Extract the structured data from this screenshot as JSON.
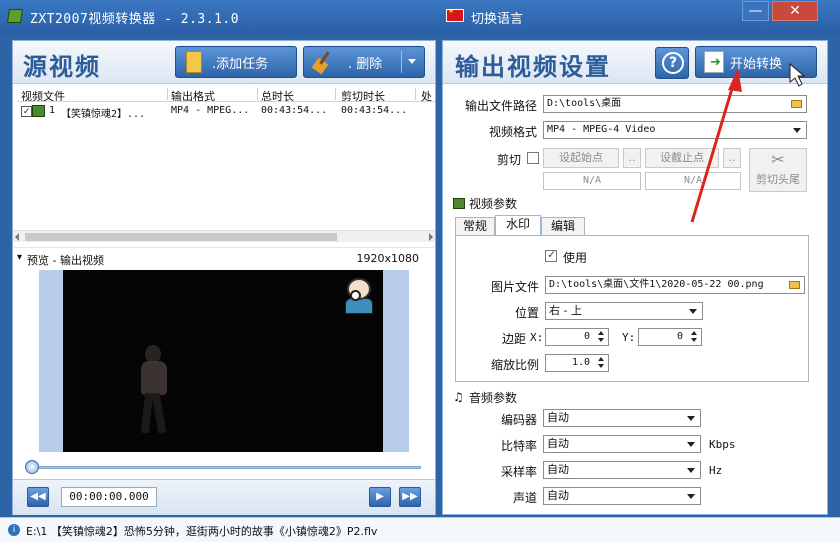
{
  "window": {
    "title": "ZXT2007视频转换器 - 2.3.1.0",
    "language_label": "切换语言",
    "minimize_glyph": "—",
    "close_glyph": "✕"
  },
  "source": {
    "title": "源视频",
    "add_task_label": ".添加任务",
    "delete_label": ". 删除",
    "columns": [
      "视频文件",
      "输出格式",
      "总时长",
      "剪切时长",
      "处"
    ],
    "rows": [
      {
        "checked": "✓",
        "index": "1",
        "file": "【笑镇惊魂2】...",
        "format": "MP4 - MPEG...",
        "duration": "00:43:54...",
        "cut_duration": "00:43:54..."
      }
    ]
  },
  "preview": {
    "label": "预览 - 输出视频",
    "resolution": "1920x1080",
    "time": "00:00:00.000",
    "prev_glyph": "◀◀",
    "play_glyph": "▶",
    "next_glyph": "▶▶"
  },
  "output": {
    "title": "输出视频设置",
    "help_glyph": "?",
    "start_label": "开始转换",
    "path_label": "输出文件路径",
    "path_value": "D:\\tools\\桌面",
    "format_label": "视频格式",
    "format_value": "MP4 - MPEG-4 Video",
    "cut_label": "剪切",
    "set_start_label": "设起始点",
    "set_end_label": "设截止点",
    "more_glyph": "..",
    "start_value": "N/A",
    "end_value": "N/A",
    "cut_head_tail_label": "剪切头尾",
    "video_params_title": "视频参数",
    "tabs": [
      "常规",
      "水印",
      "编辑"
    ],
    "watermark": {
      "use_label": "使用",
      "image_label": "图片文件",
      "image_value": "D:\\tools\\桌面\\文件1\\2020-05-22 00.png",
      "position_label": "位置",
      "position_value": "右 - 上",
      "margin_label": "边距",
      "x_label": "X:",
      "x_value": "0",
      "y_label": "Y:",
      "y_value": "0",
      "scale_label": "缩放比例",
      "scale_value": "1.0"
    },
    "audio_params_title": "音频参数",
    "encoder_label": "编码器",
    "encoder_value": "自动",
    "bitrate_label": "比特率",
    "bitrate_value": "自动",
    "bitrate_unit": "Kbps",
    "samplerate_label": "采样率",
    "samplerate_value": "自动",
    "samplerate_unit": "Hz",
    "channel_label": "声道",
    "channel_value": "自动"
  },
  "status": {
    "icon_glyph": "i",
    "text": "E:\\1 【笑镇惊魂2】恐怖5分钟，逛街两小时的故事《小镇惊魂2》P2.flv"
  },
  "colors": {
    "accent": "#2e63a8",
    "annotation_arrow": "#d9261c"
  }
}
